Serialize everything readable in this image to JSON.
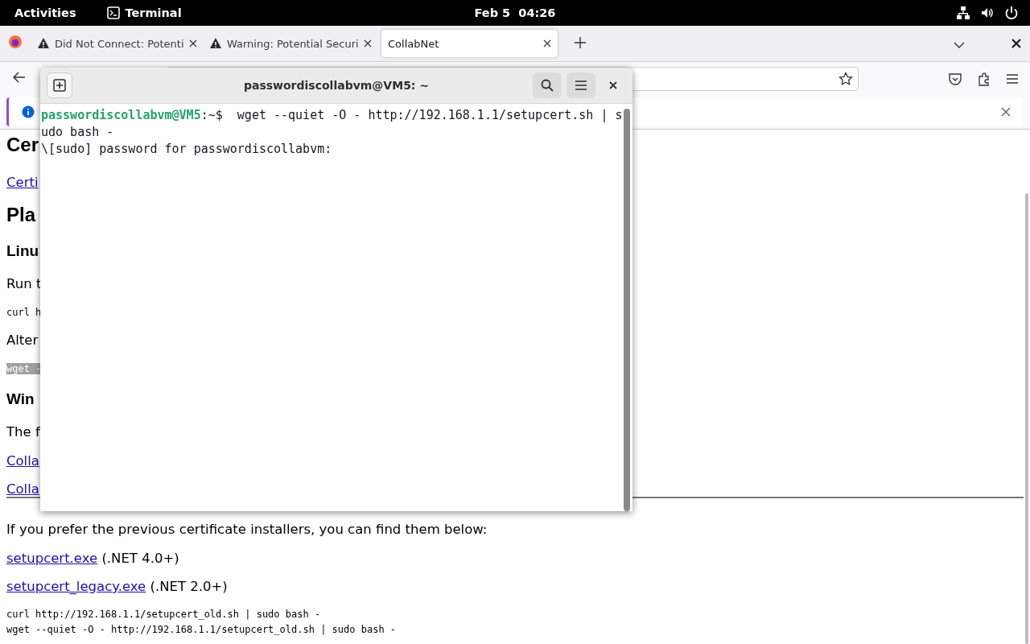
{
  "top_bar": {
    "activities": "Activities",
    "app": "Terminal",
    "clock": "Feb 5  04:26"
  },
  "browser": {
    "tabs": [
      {
        "title": "Did Not Connect: Potenti",
        "kind": "warning",
        "selected": false
      },
      {
        "title": "Warning: Potential Securi",
        "kind": "warning",
        "selected": false
      },
      {
        "title": "CollabNet",
        "kind": "plain",
        "selected": true
      }
    ],
    "page": {
      "blocks": [
        {
          "kind": "h1",
          "text": "Cer"
        },
        {
          "kind": "link",
          "text": "Certi"
        },
        {
          "kind": "h2",
          "text": "Pla"
        },
        {
          "kind": "h3",
          "text": "Linu"
        },
        {
          "kind": "p",
          "text": "Run t"
        },
        {
          "kind": "code",
          "text": "curl h"
        },
        {
          "kind": "p",
          "text": "Alter"
        },
        {
          "kind": "code",
          "text": "wget -",
          "selected": true
        },
        {
          "kind": "h3",
          "text": "Win"
        },
        {
          "kind": "p",
          "text": "The f"
        },
        {
          "kind": "link",
          "text": "Colla"
        },
        {
          "kind": "link",
          "text": "Colla"
        },
        {
          "kind": "hr"
        },
        {
          "kind": "p",
          "text": "If you prefer the previous certificate installers, you can find them below:"
        },
        {
          "kind": "link",
          "text": "setupcert.exe",
          "suffix": " (.NET 4.0+)"
        },
        {
          "kind": "link",
          "text": "setupcert_legacy.exe",
          "suffix": " (.NET 2.0+)"
        },
        {
          "kind": "pre",
          "lines": [
            "curl http://192.168.1.1/setupcert_old.sh | sudo bash -",
            "wget --quiet -O - http://192.168.1.1/setupcert_old.sh | sudo bash -"
          ]
        }
      ]
    }
  },
  "terminal": {
    "title": "passwordiscollabvm@VM5: ~",
    "lines": [
      {
        "kind": "prompt",
        "user": "passwordiscollabvm@VM5",
        "path": ":~$",
        "command": "  wget --quiet -O - http://192.168.1.1/setupcert.sh | s"
      },
      {
        "kind": "output",
        "text": "udo bash -"
      },
      {
        "kind": "output",
        "text": "\\[sudo] password for passwordiscollabvm:"
      }
    ]
  }
}
